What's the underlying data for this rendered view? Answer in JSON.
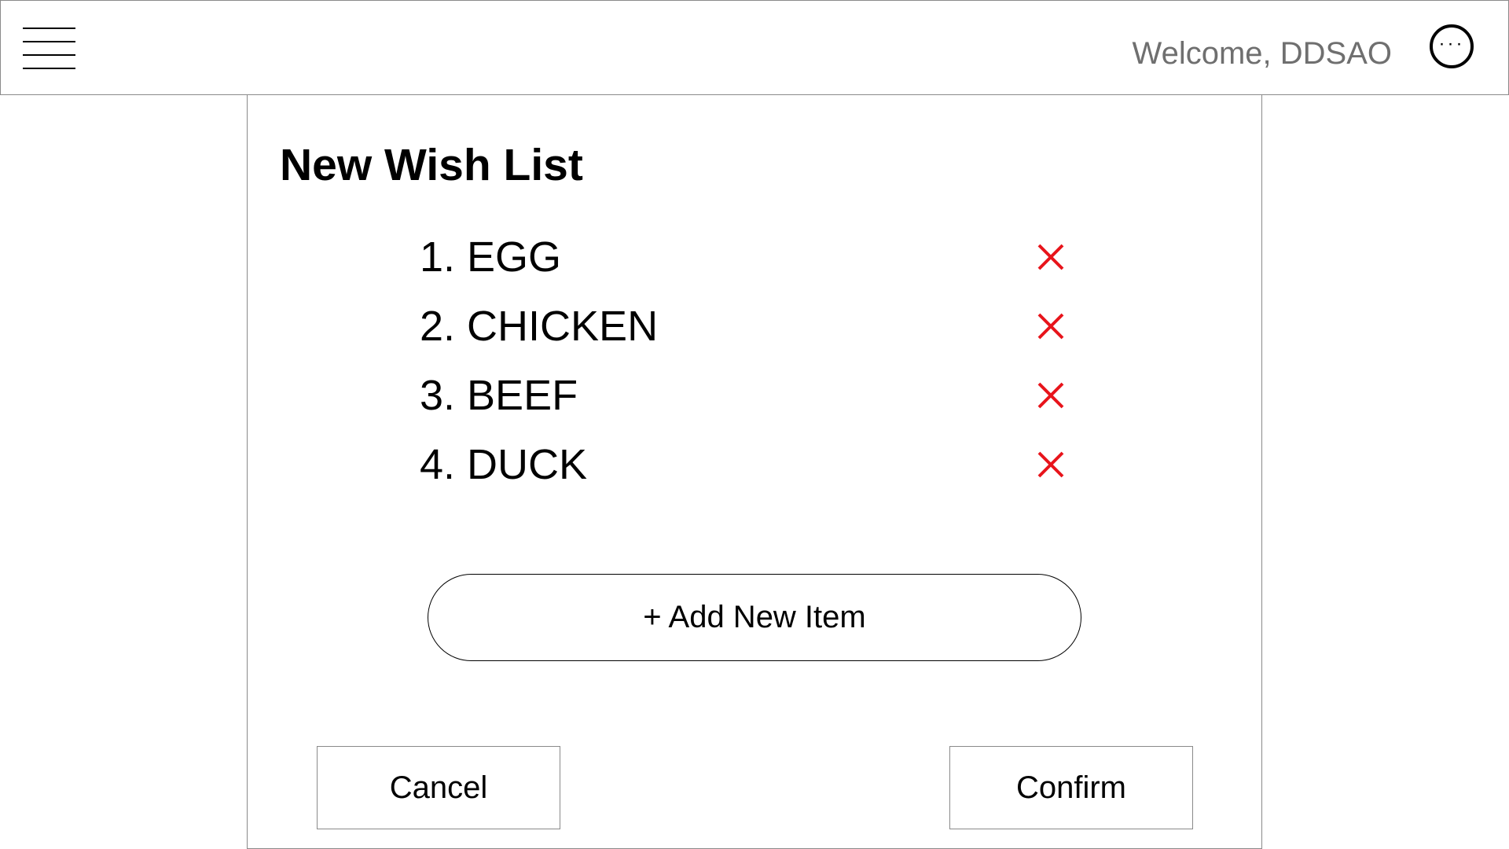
{
  "header": {
    "welcome_text": "Welcome, DDSAO",
    "menu_icon": "hamburger-menu-icon",
    "more_icon": "more-options-icon",
    "more_glyph": "···"
  },
  "dialog": {
    "title": "New Wish List",
    "items": [
      {
        "label": "1. EGG",
        "remove_icon": "remove-x-icon"
      },
      {
        "label": "2. CHICKEN",
        "remove_icon": "remove-x-icon"
      },
      {
        "label": "3. BEEF",
        "remove_icon": "remove-x-icon"
      },
      {
        "label": "4. DUCK",
        "remove_icon": "remove-x-icon"
      }
    ],
    "add_button_label": "+ Add New Item",
    "cancel_label": "Cancel",
    "confirm_label": "Confirm"
  },
  "colors": {
    "remove_icon": "#e8141b",
    "welcome_text": "#6f6f6f",
    "border": "#8a8a8a"
  }
}
